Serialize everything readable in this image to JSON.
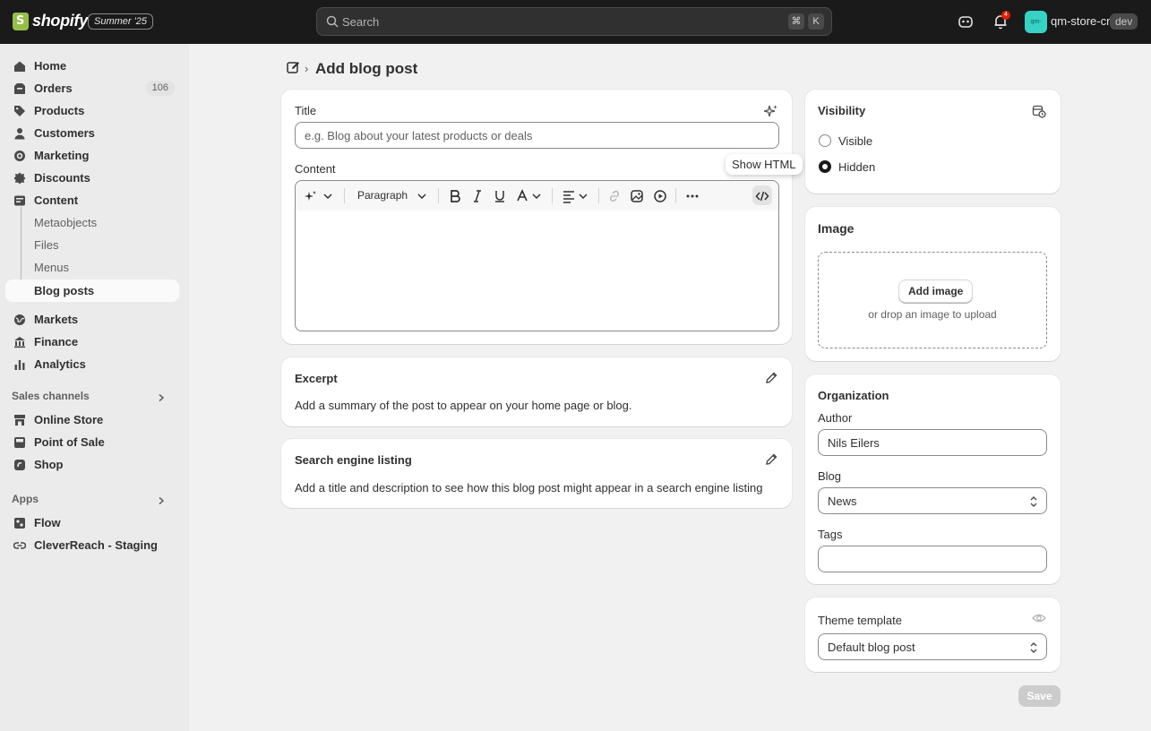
{
  "topbar": {
    "logo_text": "shopify",
    "edition_badge": "Summer '25",
    "search_placeholder": "Search",
    "shortcut_keys": [
      "⌘",
      "K"
    ],
    "notification_count": "4",
    "store_avatar_text": "qm-",
    "store_name": "qm-store-cr",
    "env_badge": "dev"
  },
  "sidebar": {
    "items": [
      {
        "label": "Home",
        "icon": "home-icon"
      },
      {
        "label": "Orders",
        "icon": "orders-icon",
        "count": "106"
      },
      {
        "label": "Products",
        "icon": "tag-icon"
      },
      {
        "label": "Customers",
        "icon": "person-icon"
      },
      {
        "label": "Marketing",
        "icon": "target-icon"
      },
      {
        "label": "Discounts",
        "icon": "discount-icon"
      },
      {
        "label": "Content",
        "icon": "content-icon"
      }
    ],
    "content_subitems": [
      "Metaobjects",
      "Files",
      "Menus",
      "Blog posts"
    ],
    "items2": [
      {
        "label": "Markets",
        "icon": "globe-icon"
      },
      {
        "label": "Finance",
        "icon": "bank-icon"
      },
      {
        "label": "Analytics",
        "icon": "chart-icon"
      }
    ],
    "sales_channels_heading": "Sales channels",
    "sales_channels": [
      {
        "label": "Online Store",
        "icon": "store-icon"
      },
      {
        "label": "Point of Sale",
        "icon": "pos-icon"
      },
      {
        "label": "Shop",
        "icon": "shop-icon"
      }
    ],
    "apps_heading": "Apps",
    "apps": [
      {
        "label": "Flow",
        "icon": "flow-icon"
      },
      {
        "label": "CleverReach - Staging",
        "icon": "link-icon"
      }
    ]
  },
  "page": {
    "title": "Add blog post"
  },
  "main_card": {
    "title_label": "Title",
    "title_placeholder": "e.g. Blog about your latest products or deals",
    "content_label": "Content",
    "paragraph_select": "Paragraph",
    "tooltip": "Show HTML"
  },
  "excerpt": {
    "heading": "Excerpt",
    "description": "Add a summary of the post to appear on your home page or blog."
  },
  "seo": {
    "heading": "Search engine listing",
    "description": "Add a title and description to see how this blog post might appear in a search engine listing"
  },
  "visibility": {
    "heading": "Visibility",
    "options": [
      "Visible",
      "Hidden"
    ],
    "selected": "Hidden"
  },
  "image": {
    "heading": "Image",
    "add_button": "Add image",
    "drop_text": "or drop an image to upload"
  },
  "organization": {
    "heading": "Organization",
    "author_label": "Author",
    "author_value": "Nils Eilers",
    "blog_label": "Blog",
    "blog_value": "News",
    "tags_label": "Tags",
    "tags_value": ""
  },
  "theme": {
    "label": "Theme template",
    "value": "Default blog post"
  },
  "actions": {
    "save": "Save"
  },
  "colors": {
    "topbar_bg": "#1a1a1a",
    "page_bg": "#f1f1f1",
    "sidebar_bg": "#ebebeb",
    "save_disabled": "#cccccc",
    "notification_red": "#e51c00"
  }
}
